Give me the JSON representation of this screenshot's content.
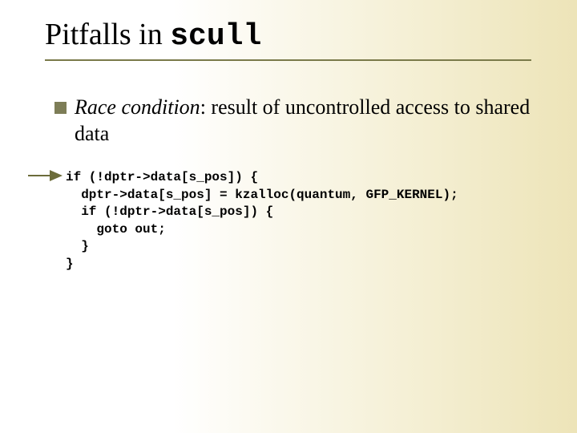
{
  "title": {
    "prefix": "Pitfalls in ",
    "mono": "scull"
  },
  "bullet": {
    "term": "Race condition",
    "rest": ":  result of uncontrolled access to shared data"
  },
  "code": {
    "l1": "if (!dptr->data[s_pos]) {",
    "l2": "  dptr->data[s_pos] = kzalloc(quantum, GFP_KERNEL);",
    "l3": "  if (!dptr->data[s_pos]) {",
    "l4": "    goto out;",
    "l5": "  }",
    "l6": "}"
  },
  "colors": {
    "accent": "#7d7d57",
    "arrow": "#6c6c3a"
  }
}
